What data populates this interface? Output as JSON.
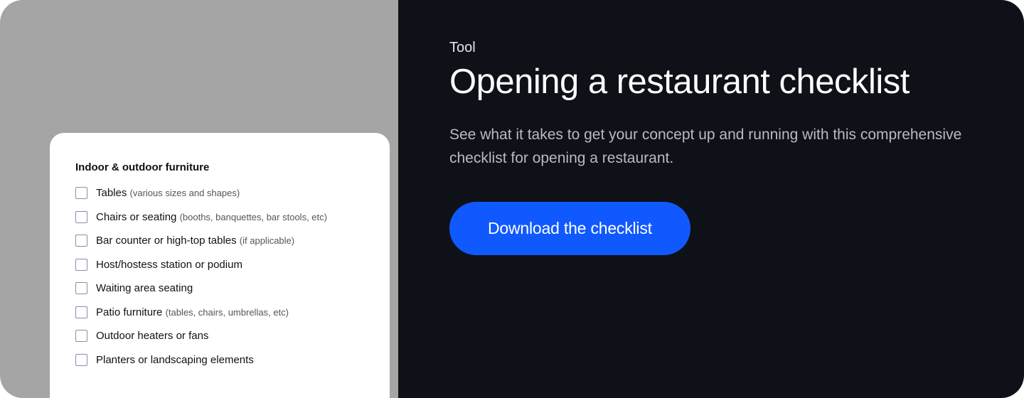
{
  "left": {
    "checklist_title": "Indoor & outdoor furniture",
    "items": [
      {
        "label": "Tables",
        "note": "(various sizes and shapes)"
      },
      {
        "label": "Chairs or seating",
        "note": "(booths, banquettes, bar stools, etc)"
      },
      {
        "label": "Bar counter or high-top tables",
        "note": "(if applicable)"
      },
      {
        "label": "Host/hostess station or podium",
        "note": ""
      },
      {
        "label": "Waiting area seating",
        "note": ""
      },
      {
        "label": "Patio furniture",
        "note": "(tables, chairs, umbrellas, etc)"
      },
      {
        "label": "Outdoor heaters or fans",
        "note": ""
      },
      {
        "label": "Planters or landscaping elements",
        "note": ""
      }
    ]
  },
  "right": {
    "eyebrow": "Tool",
    "heading": "Opening a restaurant checklist",
    "description": "See what it takes to get your concept up and running with this comprehensive checklist for opening a restaurant.",
    "cta_label": "Download the checklist"
  }
}
